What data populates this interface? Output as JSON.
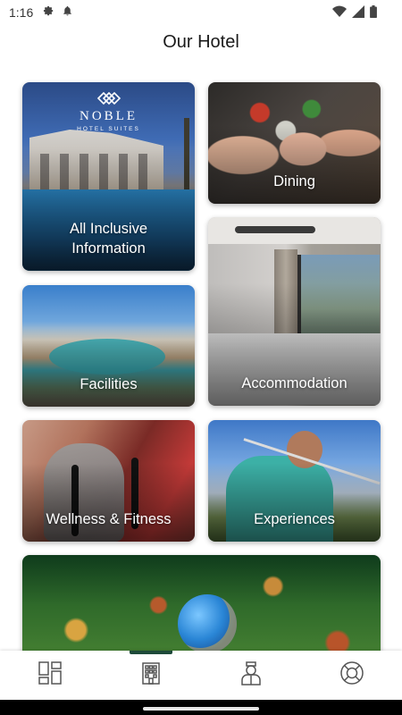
{
  "status_bar": {
    "time": "1:16",
    "icons_left": [
      "gear-icon",
      "notification-bell-icon"
    ],
    "icons_right": [
      "wifi-icon",
      "signal-icon",
      "battery-icon"
    ]
  },
  "header": {
    "title": "Our Hotel"
  },
  "hotel_logo": {
    "name": "NOBLE",
    "subtitle": "HOTEL SUITES"
  },
  "cards": [
    {
      "id": "all-inclusive",
      "label": "All Inclusive\nInformation"
    },
    {
      "id": "dining",
      "label": "Dining"
    },
    {
      "id": "accommodation",
      "label": "Accommodation"
    },
    {
      "id": "facilities",
      "label": "Facilities"
    },
    {
      "id": "wellness",
      "label": "Wellness & Fitness"
    },
    {
      "id": "experiences",
      "label": "Experiences"
    },
    {
      "id": "sustainability",
      "label": ""
    }
  ],
  "bottom_nav": {
    "items": [
      {
        "icon": "dashboard-grid-icon",
        "active": false
      },
      {
        "icon": "hotel-building-icon",
        "active": true
      },
      {
        "icon": "concierge-staff-icon",
        "active": false
      },
      {
        "icon": "lifebuoy-icon",
        "active": false
      }
    ],
    "accent_color": "#1e4a3a"
  }
}
